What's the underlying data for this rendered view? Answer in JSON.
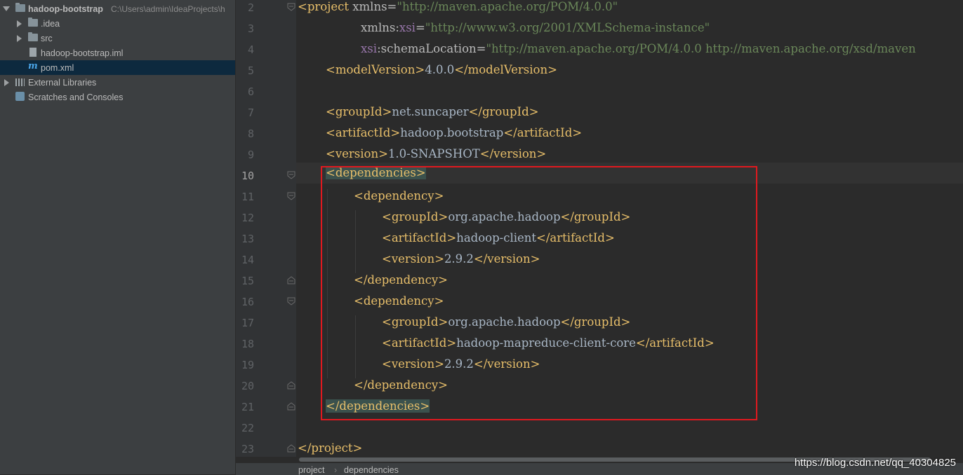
{
  "project_tree": {
    "root": {
      "name": "hadoop-bootstrap",
      "path": "C:\\Users\\admin\\IdeaProjects\\h"
    },
    "items": [
      {
        "label": ".idea",
        "icon": "folder-icon"
      },
      {
        "label": "src",
        "icon": "folder-icon"
      },
      {
        "label": "hadoop-bootstrap.iml",
        "icon": "iml-file-icon"
      },
      {
        "label": "pom.xml",
        "icon": "maven-icon",
        "selected": true
      }
    ],
    "external_libraries": "External Libraries",
    "scratches": "Scratches and Consoles"
  },
  "editor": {
    "line_numbers": [
      "2",
      "3",
      "4",
      "5",
      "6",
      "7",
      "8",
      "9",
      "10",
      "11",
      "12",
      "13",
      "14",
      "15",
      "16",
      "17",
      "18",
      "19",
      "20",
      "21",
      "22",
      "23"
    ],
    "current_line": "10",
    "code": {
      "l2": {
        "open": "<project",
        "attr": " xmlns=",
        "val": "\"http://maven.apache.org/POM/4.0.0\""
      },
      "l3": {
        "attr": "xmlns:",
        "ns": "xsi",
        "eq": "=",
        "val": "\"http://www.w3.org/2001/XMLSchema-instance\""
      },
      "l4": {
        "ns": "xsi",
        "attr": ":schemaLocation=",
        "val": "\"http://maven.apache.org/POM/4.0.0 http://maven.apache.org/xsd/maven"
      },
      "l5": {
        "open": "<modelVersion>",
        "text": "4.0.0",
        "close": "</modelVersion>"
      },
      "l7": {
        "open": "<groupId>",
        "text": "net.suncaper",
        "close": "</groupId>"
      },
      "l8": {
        "open": "<artifactId>",
        "text": "hadoop.bootstrap",
        "close": "</artifactId>"
      },
      "l9": {
        "open": "<version>",
        "text": "1.0-SNAPSHOT",
        "close": "</version>"
      },
      "l10": {
        "open": "<dependencies>"
      },
      "l11": {
        "open": "<dependency>"
      },
      "l12": {
        "open": "<groupId>",
        "text": "org.apache.hadoop",
        "close": "</groupId>"
      },
      "l13": {
        "open": "<artifactId>",
        "text": "hadoop-client",
        "close": "</artifactId>"
      },
      "l14": {
        "open": "<version>",
        "text": "2.9.2",
        "close": "</version>"
      },
      "l15": {
        "close": "</dependency>"
      },
      "l16": {
        "open": "<dependency>"
      },
      "l17": {
        "open": "<groupId>",
        "text": "org.apache.hadoop",
        "close": "</groupId>"
      },
      "l18": {
        "open": "<artifactId>",
        "text": "hadoop-mapreduce-client-core",
        "close": "</artifactId>"
      },
      "l19": {
        "open": "<version>",
        "text": "2.9.2",
        "close": "</version>"
      },
      "l20": {
        "close": "</dependency>"
      },
      "l21": {
        "close": "</dependencies>"
      },
      "l23": {
        "close": "</project>"
      }
    }
  },
  "breadcrumb": {
    "items": [
      "project",
      "dependencies"
    ],
    "separator": "›"
  },
  "watermark": "https://blog.csdn.net/qq_40304825",
  "colors": {
    "tag": "#e8bf6a",
    "value": "#6a8759",
    "namespace": "#9876aa",
    "highlight_box": "#e0191f"
  }
}
